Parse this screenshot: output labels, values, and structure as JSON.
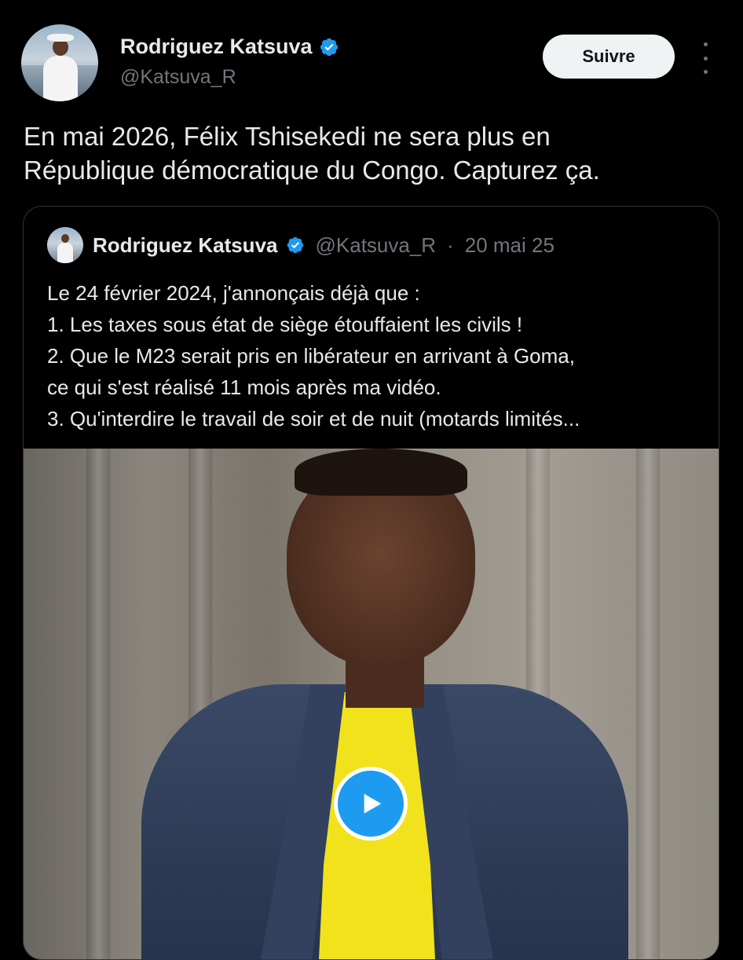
{
  "author": {
    "name": "Rodriguez Katsuva",
    "handle": "@Katsuva_R"
  },
  "follow_label": "Suivre",
  "tweet_text": "En mai 2026, Félix Tshisekedi ne sera plus en\nRépublique démocratique du Congo. Capturez ça.",
  "quote": {
    "name": "Rodriguez Katsuva",
    "handle": "@Katsuva_R",
    "separator": "·",
    "date": "20 mai 25",
    "lines": [
      "Le 24 février 2024, j'annonçais déjà que :",
      "1. Les taxes sous état de siège étouffaient les civils !",
      "2. Que le M23 serait pris en libérateur en arrivant à Goma,",
      "ce qui s'est réalisé 11 mois après ma vidéo.",
      "3. Qu'interdire le travail de soir et de nuit (motards limités..."
    ]
  },
  "colors": {
    "background": "#000000",
    "text": "#e7e9ea",
    "muted": "#71767b",
    "accent": "#1d9bf0",
    "follow_button": "#eff3f4"
  },
  "icons": [
    "verified-badge-icon",
    "more-options-icon",
    "play-icon"
  ]
}
